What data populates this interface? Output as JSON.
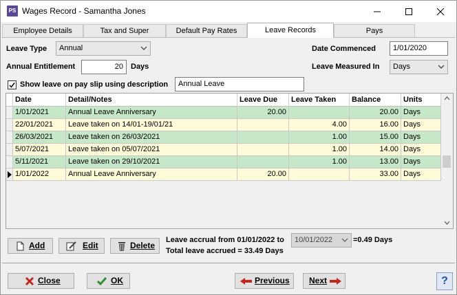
{
  "window": {
    "title": "Wages Record - Samantha Jones",
    "app_icon_text": "PS"
  },
  "tabs": [
    {
      "label": "Employee Details"
    },
    {
      "label": "Tax and Super"
    },
    {
      "label": "Default Pay Rates"
    },
    {
      "label": "Leave Records"
    },
    {
      "label": "Pays"
    }
  ],
  "form": {
    "leave_type_label": "Leave Type",
    "leave_type_value": "Annual",
    "annual_entitlement_label": "Annual Entitlement",
    "annual_entitlement_value": "20",
    "annual_entitlement_unit": "Days",
    "show_leave_label": "Show leave on pay slip using description",
    "show_leave_checked": true,
    "description_value": "Annual Leave",
    "date_commenced_label": "Date Commenced",
    "date_commenced_value": "1/01/2020",
    "leave_measured_label": "Leave Measured In",
    "leave_measured_value": "Days"
  },
  "table": {
    "headers": [
      "Date",
      "Detail/Notes",
      "Leave Due",
      "Leave Taken",
      "Balance",
      "Units"
    ],
    "rows": [
      {
        "date": "1/01/2021",
        "detail": "Annual Leave Anniversary",
        "due": "20.00",
        "taken": "",
        "balance": "20.00",
        "units": "Days",
        "color": "green"
      },
      {
        "date": "22/01/2021",
        "detail": "Leave taken on 14/01-19/01/21",
        "due": "",
        "taken": "4.00",
        "balance": "16.00",
        "units": "Days",
        "color": "yellow"
      },
      {
        "date": "26/03/2021",
        "detail": "Leave taken on 26/03/2021",
        "due": "",
        "taken": "1.00",
        "balance": "15.00",
        "units": "Days",
        "color": "green"
      },
      {
        "date": "5/07/2021",
        "detail": "Leave taken on 05/07/2021",
        "due": "",
        "taken": "1.00",
        "balance": "14.00",
        "units": "Days",
        "color": "yellow"
      },
      {
        "date": "5/11/2021",
        "detail": "Leave taken on 29/10/2021",
        "due": "",
        "taken": "1.00",
        "balance": "13.00",
        "units": "Days",
        "color": "green"
      },
      {
        "date": "1/01/2022",
        "detail": "Annual Leave Anniversary",
        "due": "20.00",
        "taken": "",
        "balance": "33.00",
        "units": "Days",
        "color": "yellow"
      }
    ]
  },
  "actions": {
    "add": "Add",
    "edit": "Edit",
    "delete": "Delete"
  },
  "accrual": {
    "label": "Leave accrual from 01/01/2022 to",
    "to_date": "10/01/2022",
    "result": "=0.49 Days",
    "total": "Total leave accrued = 33.49 Days"
  },
  "footer": {
    "close": "Close",
    "ok": "OK",
    "previous": "Previous",
    "next": "Next",
    "help": "?"
  }
}
